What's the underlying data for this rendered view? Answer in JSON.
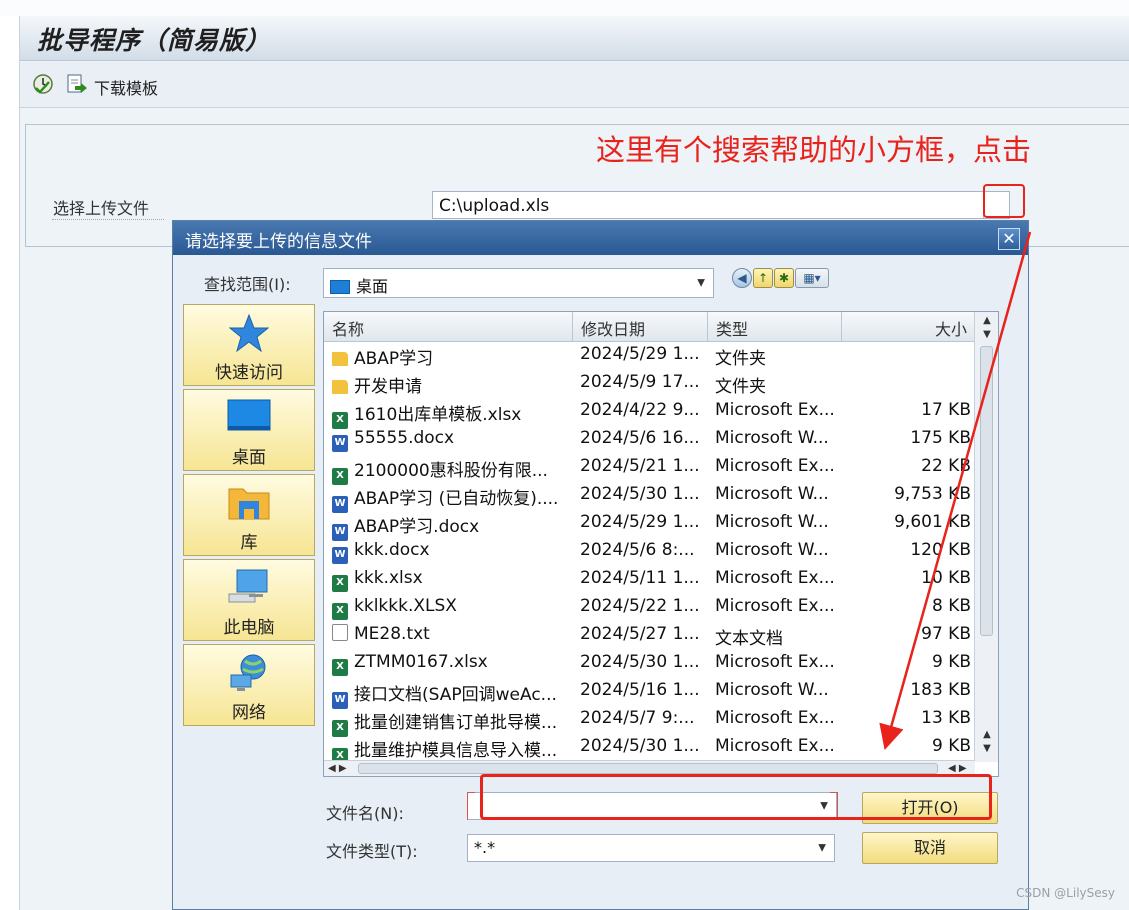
{
  "window": {
    "title": "批导程序（简易版）"
  },
  "toolbar": {
    "download_label": "下载模板",
    "execute_icon": "execute-icon",
    "download_icon": "download-template-icon"
  },
  "form": {
    "upload_label": "选择上传文件",
    "upload_value": "C:\\upload.xls"
  },
  "annotation": {
    "text": "这里有个搜索帮助的小方框，点击",
    "color": "#e8231b"
  },
  "dialog": {
    "title": "请选择要上传的信息文件",
    "lookin_label": "查找范围(I):",
    "lookin_value": "桌面",
    "places": [
      {
        "label": "快速访问",
        "icon": "star-icon"
      },
      {
        "label": "桌面",
        "icon": "desktop-icon"
      },
      {
        "label": "库",
        "icon": "library-icon"
      },
      {
        "label": "此电脑",
        "icon": "computer-icon"
      },
      {
        "label": "网络",
        "icon": "network-icon"
      }
    ],
    "columns": [
      "名称",
      "修改日期",
      "类型",
      "大小"
    ],
    "files": [
      {
        "icon": "folder",
        "name": "ABAP学习",
        "date": "2024/5/29 1...",
        "type": "文件夹",
        "size": ""
      },
      {
        "icon": "folder",
        "name": "开发申请",
        "date": "2024/5/9 17...",
        "type": "文件夹",
        "size": ""
      },
      {
        "icon": "excel",
        "name": "1610出库单模板.xlsx",
        "date": "2024/4/22 9...",
        "type": "Microsoft Ex...",
        "size": "17 KB"
      },
      {
        "icon": "word",
        "name": "55555.docx",
        "date": "2024/5/6 16...",
        "type": "Microsoft W...",
        "size": "175 KB"
      },
      {
        "icon": "excel",
        "name": "2100000惠科股份有限...",
        "date": "2024/5/21 1...",
        "type": "Microsoft Ex...",
        "size": "22 KB"
      },
      {
        "icon": "word",
        "name": "ABAP学习 (已自动恢复)....",
        "date": "2024/5/30 1...",
        "type": "Microsoft W...",
        "size": "9,753 KB"
      },
      {
        "icon": "word",
        "name": "ABAP学习.docx",
        "date": "2024/5/29 1...",
        "type": "Microsoft W...",
        "size": "9,601 KB"
      },
      {
        "icon": "word",
        "name": "kkk.docx",
        "date": "2024/5/6 8:...",
        "type": "Microsoft W...",
        "size": "120 KB"
      },
      {
        "icon": "excel",
        "name": "kkk.xlsx",
        "date": "2024/5/11 1...",
        "type": "Microsoft Ex...",
        "size": "10 KB"
      },
      {
        "icon": "excel",
        "name": "kklkkk.XLSX",
        "date": "2024/5/22 1...",
        "type": "Microsoft Ex...",
        "size": "8 KB"
      },
      {
        "icon": "text",
        "name": "ME28.txt",
        "date": "2024/5/27 1...",
        "type": "文本文档",
        "size": "97 KB"
      },
      {
        "icon": "excel",
        "name": "ZTMM0167.xlsx",
        "date": "2024/5/30 1...",
        "type": "Microsoft Ex...",
        "size": "9 KB"
      },
      {
        "icon": "word",
        "name": "接口文档(SAP回调weAc...",
        "date": "2024/5/16 1...",
        "type": "Microsoft W...",
        "size": "183 KB"
      },
      {
        "icon": "excel",
        "name": "批量创建销售订单批导模...",
        "date": "2024/5/7 9:...",
        "type": "Microsoft Ex...",
        "size": "13 KB"
      },
      {
        "icon": "excel",
        "name": "批量维护模具信息导入模...",
        "date": "2024/5/30 1...",
        "type": "Microsoft Ex...",
        "size": "9 KB"
      }
    ],
    "filename_label": "文件名(N):",
    "filename_value": "",
    "filetype_label": "文件类型(T):",
    "filetype_value": "*.*",
    "open_button": "打开(O)",
    "cancel_button": "取消"
  },
  "watermark": "CSDN @LilySesy"
}
